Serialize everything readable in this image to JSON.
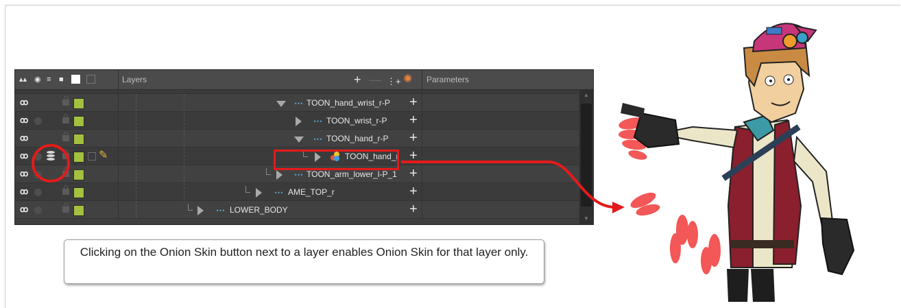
{
  "panel": {
    "header": {
      "layers_label": "Layers",
      "parameters_label": "Parameters",
      "icons": [
        "animate-icon",
        "enable-icon",
        "onion-skin-icon",
        "lock-icon",
        "color-swatch-icon",
        "ghost-icon"
      ],
      "tools": [
        "add-layer-icon",
        "remove-layer-icon",
        "add-peg-icon",
        "add-deformation-icon"
      ]
    },
    "rows": [
      {
        "name": "TOON_hand_wrist_r-P",
        "type": "peg",
        "expander": "expanded",
        "onion_on": false
      },
      {
        "name": "TOON_wrist_r-P",
        "type": "peg",
        "expander": "collapsed",
        "onion_on": false
      },
      {
        "name": "TOON_hand_r-P",
        "type": "peg",
        "expander": "expanded",
        "onion_on": false
      },
      {
        "name": "TOON_hand_r",
        "type": "drawing",
        "expander": "collapsed",
        "onion_on": true,
        "selected": true
      },
      {
        "name": "TOON_arm_lower_l-P_1",
        "type": "peg",
        "expander": "collapsed",
        "onion_on": false
      },
      {
        "name": "AME_TOP_r",
        "type": "peg",
        "expander": "collapsed",
        "onion_on": false
      },
      {
        "name": "LOWER_BODY",
        "type": "peg",
        "expander": "collapsed",
        "onion_on": false
      }
    ],
    "enable_icon_text": "ꝏ",
    "swatch_color": "#a3c13f"
  },
  "caption": {
    "text": "Clicking on the Onion Skin button next to a layer enables Onion Skin for that layer only."
  },
  "colors": {
    "highlight": "#e51a1a",
    "panel_bg": "#3e3e3e",
    "peg_icon": "#54b3e9"
  }
}
